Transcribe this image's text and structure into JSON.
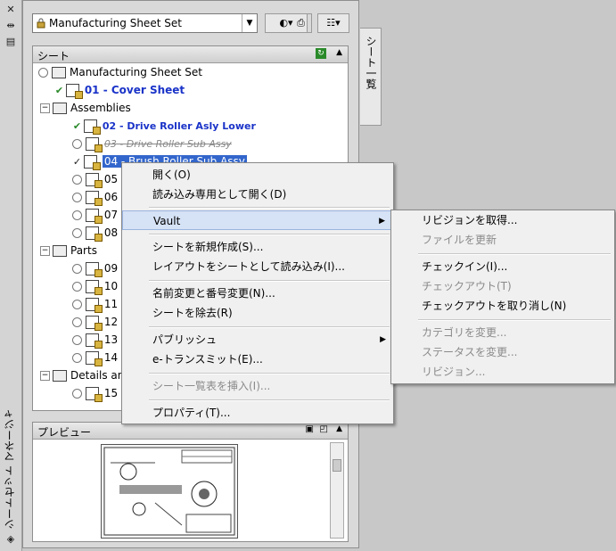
{
  "palette": {
    "vertical_title": "シートセット マネージャ",
    "sheet_set_select": "Manufacturing Sheet Set",
    "side_tab": "シート一覧",
    "sheets_header": "シート",
    "preview_header": "プレビュー"
  },
  "tree": {
    "root": "Manufacturing Sheet Set",
    "cover": "01 - Cover Sheet",
    "assemblies": "Assemblies",
    "s02": "02 - Drive Roller Asly Lower",
    "s03": "03 - Drive Roller Sub Assy",
    "s04": "04 - Brush Roller Sub Assy",
    "s05": "05",
    "s06": "06",
    "s07": "07",
    "s08": "08",
    "parts": "Parts",
    "s09": "09",
    "s10": "10",
    "s11": "11",
    "s12": "12",
    "s13": "13",
    "s14": "14",
    "details": "Details an",
    "s15": "15"
  },
  "context_menu": {
    "open": "開く(O)",
    "open_readonly": "読み込み専用として開く(D)",
    "vault": "Vault",
    "new_sheet": "シートを新規作成(S)...",
    "import_layout": "レイアウトをシートとして読み込み(I)...",
    "rename_renumber": "名前変更と番号変更(N)...",
    "remove_sheet": "シートを除去(R)",
    "publish": "パブリッシュ",
    "etransmit": "e-トランスミット(E)...",
    "insert_list": "シート一覧表を挿入(I)...",
    "properties": "プロパティ(T)..."
  },
  "vault_menu": {
    "get_revision": "リビジョンを取得...",
    "refresh": "ファイルを更新",
    "check_in": "チェックイン(I)...",
    "check_out": "チェックアウト(T)",
    "undo_checkout": "チェックアウトを取り消し(N)",
    "change_category": "カテゴリを変更...",
    "change_state": "ステータスを変更...",
    "revision": "リビジョン..."
  },
  "colors": {
    "selection": "#3366cc",
    "sheet_blue": "#1a33c8",
    "menu_bg": "#f0f0f0"
  }
}
